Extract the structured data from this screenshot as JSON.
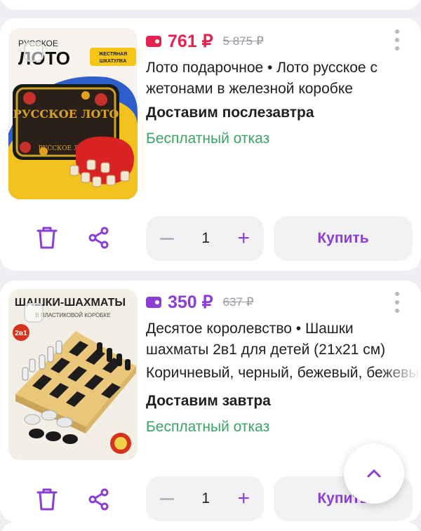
{
  "colors": {
    "accent": "#8b3ed4",
    "price_red": "#e5224f",
    "price_purple": "#8b3ed4",
    "refund_green": "#3aa466",
    "muted": "#9a9aa3"
  },
  "products": [
    {
      "image_text_top": "РУССКОЕ",
      "image_text_brand": "ЛОТО",
      "image_badge": "ЖЕСТЯНАЯ ШКАТУЛКА",
      "image_box_label": "РУССКОЕ ЛОТО",
      "price": "761 ₽",
      "old_price": "5 875 ₽",
      "wallet_icon": "wallet-icon",
      "title": "Лото подарочное • Лото русское с жетонами в железной коробке",
      "delivery": "Доставим послезавтра",
      "refund": "Бесплатный отказ",
      "quantity": "1",
      "buy_label": "Купить"
    },
    {
      "image_text_top": "ШАШКИ-ШАХМАТЫ",
      "image_text_sub": "В ПЛАСТИКОВОЙ КОРОБКЕ",
      "image_badge": "2в1",
      "price": "350 ₽",
      "old_price": "637 ₽",
      "wallet_icon": "wallet-icon",
      "title": "Десятое королевство • Шашки шахматы 2в1 для детей (21х21 см)",
      "variant": "Коричневый, черный, бежевый, бежевый",
      "delivery": "Доставим завтра",
      "refund": "Бесплатный отказ",
      "quantity": "1",
      "buy_label": "Купить"
    }
  ]
}
